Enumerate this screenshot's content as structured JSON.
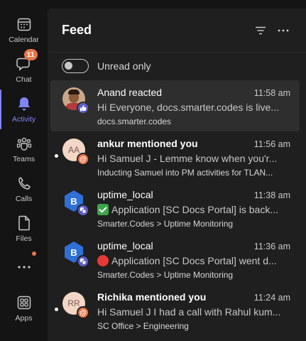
{
  "rail": {
    "items": [
      {
        "label": "Calendar",
        "icon": "calendar-icon"
      },
      {
        "label": "Chat",
        "icon": "chat-icon",
        "badge": "11"
      },
      {
        "label": "Activity",
        "icon": "bell-icon",
        "active": true
      },
      {
        "label": "Teams",
        "icon": "teams-icon"
      },
      {
        "label": "Calls",
        "icon": "phone-icon"
      },
      {
        "label": "Files",
        "icon": "file-icon"
      },
      {
        "label": "",
        "icon": "more-icon"
      },
      {
        "label": "Apps",
        "icon": "apps-icon"
      }
    ],
    "accent": "#7f85f5",
    "badge_color": "#e97548"
  },
  "feed": {
    "title": "Feed",
    "unread_only_label": "Unread only",
    "items": [
      {
        "who": "Anand reacted",
        "time": "11:58 am",
        "preview": "Hi Everyone, docs.smarter.codes is live...",
        "context": "docs.smarter.codes",
        "unread": false,
        "selected": true,
        "avatar": "photo",
        "sub_icon": "thumbs-up-icon"
      },
      {
        "who": "ankur mentioned you",
        "time": "11:56 am",
        "preview": "Hi Samuel J - Lemme know when you'r...",
        "context": "Inducting Samuel into PM activities for TLAN...",
        "unread": true,
        "avatar_initials": "AA",
        "sub_icon": "at-mention-icon"
      },
      {
        "who": "uptime_local",
        "time": "11:38 am",
        "preview": "Application [SC Docs Portal] is back...",
        "context": "Smarter.Codes > Uptime Monitoring",
        "unread": false,
        "avatar_initials": "B",
        "emoji": "check-mark-icon",
        "sub_icon": "app-icon"
      },
      {
        "who": "uptime_local",
        "time": "11:36 am",
        "preview": "Application [SC Docs Portal] went d...",
        "context": "Smarter.Codes > Uptime Monitoring",
        "unread": false,
        "avatar_initials": "B",
        "emoji": "red-circle-icon",
        "sub_icon": "app-icon"
      },
      {
        "who": "Richika mentioned you",
        "time": "11:24 am",
        "preview": "Hi Samuel J I had a call with Rahul kum...",
        "context": "SC Office > Engineering",
        "unread": true,
        "avatar_initials": "RR",
        "sub_icon": "at-mention-icon"
      }
    ]
  }
}
